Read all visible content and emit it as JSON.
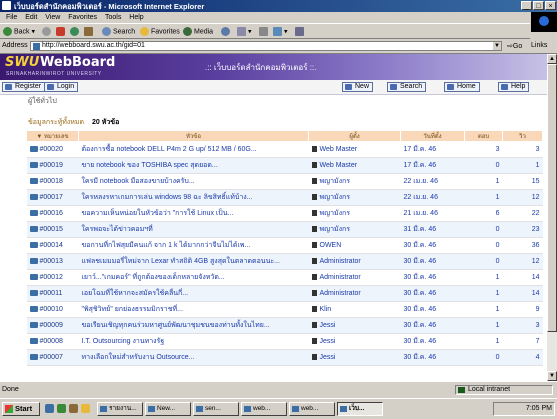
{
  "window": {
    "title": "เว็บบอร์ดสำนักคอมพิวเตอร์ - Microsoft Internet Explorer",
    "min": "_",
    "max": "□",
    "close": "×"
  },
  "menu": [
    "File",
    "Edit",
    "View",
    "Favorites",
    "Tools",
    "Help"
  ],
  "toolbar": {
    "back": "Back",
    "search": "Search",
    "favorites": "Favorites",
    "media": "Media"
  },
  "address": {
    "label": "Address",
    "url": "http://webboard.swu.ac.th/gid=01",
    "go": "Go",
    "links": "Links"
  },
  "banner": {
    "logo_swu": "SWU",
    "logo_wb": "WebBoard",
    "university": "SRINAKHARINWIROT UNIVERSITY",
    "board_title": ".:: เว็บบอร์ดสำนักคอมพิวเตอร์ ::."
  },
  "buttons": {
    "register": "Register",
    "login": "Login",
    "new": "New",
    "search": "Search",
    "home": "Home",
    "help": "Help"
  },
  "category": "ผู้ใช้ทั่วไป",
  "summary": {
    "label": "ข้อมูลกระทู้ทั้งหมด",
    "count": "20 หัวข้อ"
  },
  "table": {
    "headers": [
      "▼ หมายเลข",
      "หัวข้อ",
      "ผู้ตั้ง",
      "วันที่ตั้ง",
      "ตอบ",
      "วิว"
    ],
    "rows": [
      {
        "id": "#00020",
        "subject": "ต้องการซื้อ notebook DELL P4m 2 G up/ 512 MB / 60G...",
        "user": "Web Master",
        "date": "17 มี.ค. 46",
        "replies": "3",
        "views": "3"
      },
      {
        "id": "#00019",
        "subject": "ขาย notebook ของ TOSHIBA spec สุดยอด...",
        "user": "Web Master",
        "date": "17 มี.ค. 46",
        "replies": "0",
        "views": "1"
      },
      {
        "id": "#00018",
        "subject": "ใครมี notebook มือสองขายบ้างครับ...",
        "user": "พญามังกร",
        "date": "22 เม.ย. 46",
        "replies": "1",
        "views": "15"
      },
      {
        "id": "#00017",
        "subject": "ใครหลงรหาเกมการเล่น windows 98 ฉะ ลิขสิทธิ์แท้บ้าง...",
        "user": "พญามังกร",
        "date": "22 เม.ย. 46",
        "replies": "1",
        "views": "12"
      },
      {
        "id": "#00016",
        "subject": "ขอความเห็นหน่อยในหัวข้อว่า \"การใช้ Linux เป็น...",
        "user": "พญามังกร",
        "date": "21 เม.ย. 46",
        "replies": "6",
        "views": "22"
      },
      {
        "id": "#00015",
        "subject": "ใครพอจะได้ข่าวคอมฯที่",
        "user": "พญามังกร",
        "date": "31 มี.ค. 46",
        "replies": "0",
        "views": "23"
      },
      {
        "id": "#00014",
        "subject": "ขอกานที่กไฟสุยมีคนแก้ จาก 1 k ได้มากกว่าจีนไม่ได้เพ...",
        "user": "OWEN",
        "date": "30 มี.ค. 46",
        "replies": "0",
        "views": "36"
      },
      {
        "id": "#00013",
        "subject": "แฟลชเมมมอรี่ใหม่จาก Lexar ทำสถิติ 4GB สูงสุดในตลาดตอนนะ...",
        "user": "Administrator",
        "date": "30 มี.ค. 46",
        "replies": "0",
        "views": "12"
      },
      {
        "id": "#00012",
        "subject": "เยาว์...\"เกมคอร์\" ที่ถูกต้องของเด็กหลายจังหวัด...",
        "user": "Administrator",
        "date": "30 มี.ค. 46",
        "replies": "1",
        "views": "14"
      },
      {
        "id": "#00011",
        "subject": "เอยโฉมที่ใช้หากจะสมัครใช้คลื่นกี่...",
        "user": "Administrator",
        "date": "30 มี.ค. 46",
        "replies": "1",
        "views": "14"
      },
      {
        "id": "#00010",
        "subject": "\"พิสุชิวิทย์\" ยกย่องธรรมมิกราชที่...",
        "user": "Klin",
        "date": "30 มี.ค. 46",
        "replies": "1",
        "views": "9"
      },
      {
        "id": "#00009",
        "subject": "ขอเรียนเชิญทุกคนร่วมหาศูนย์พัฒนาชุมชนของท่านทั้งในไทย...",
        "user": "Jessi",
        "date": "30 มี.ค. 46",
        "replies": "1",
        "views": "3"
      },
      {
        "id": "#00008",
        "subject": "I.T. Outsourcing งานทางรัฐ",
        "user": "Jessi",
        "date": "30 มี.ค. 46",
        "replies": "1",
        "views": "7"
      },
      {
        "id": "#00007",
        "subject": "ทางเลือกใหม่สำหรับงาน Outsource...",
        "user": "Jessi",
        "date": "30 มี.ค. 46",
        "replies": "0",
        "views": "4"
      }
    ]
  },
  "status": {
    "left": "Done",
    "zone": "Local intranet"
  },
  "taskbar": {
    "start": "Start",
    "tasks": [
      "รายงาน...",
      "New...",
      "sen...",
      "web...",
      "web...",
      "เว็บ..."
    ],
    "clock": "7:05 PM"
  },
  "colors": {
    "title_bar": "#0a246a",
    "banner": "#3a186e",
    "header_bg": "#f8d8b8",
    "link": "#1a3aa8"
  }
}
